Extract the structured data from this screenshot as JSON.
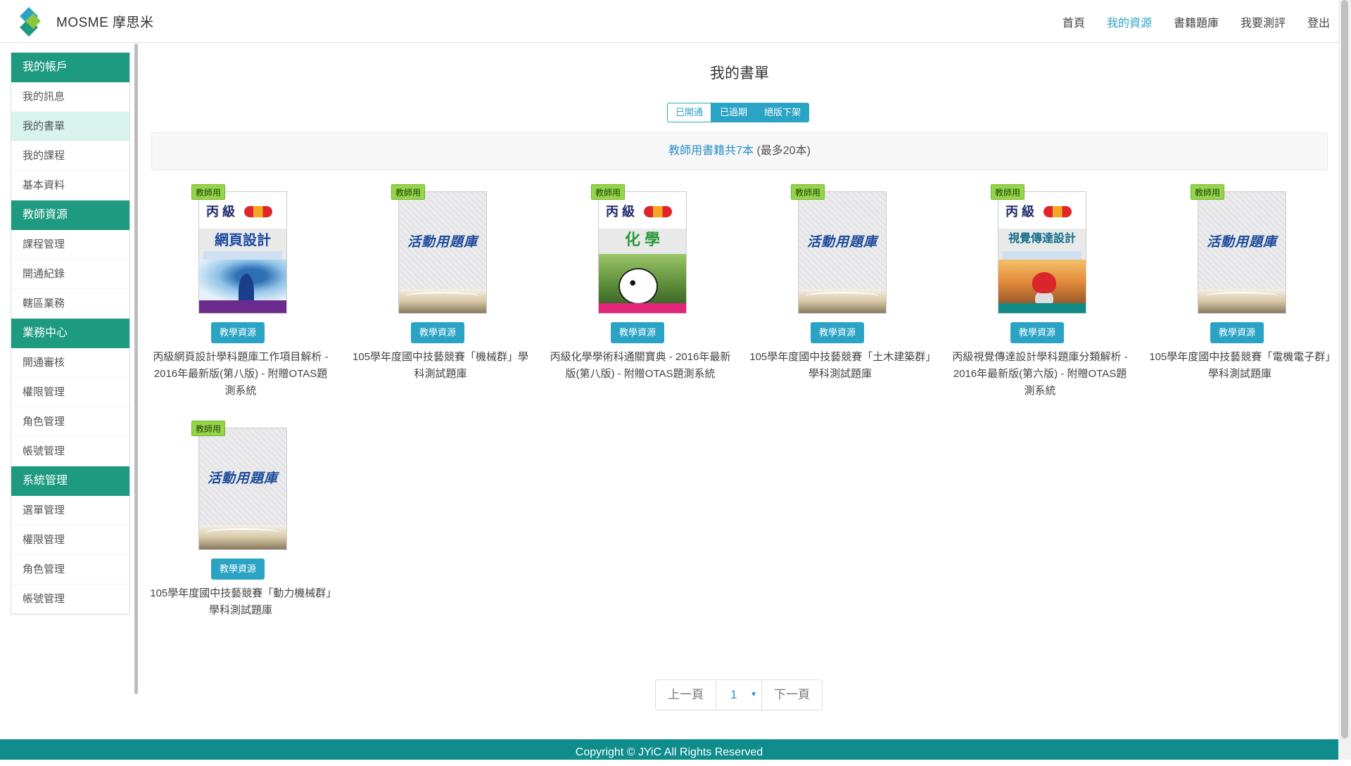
{
  "brand": {
    "name": "MOSME 摩思米"
  },
  "nav": [
    {
      "label": "首頁",
      "active": false
    },
    {
      "label": "我的資源",
      "active": true
    },
    {
      "label": "書籍題庫",
      "active": false
    },
    {
      "label": "我要測評",
      "active": false
    },
    {
      "label": "登出",
      "active": false
    }
  ],
  "sidebar": {
    "sections": [
      {
        "title": "我的帳戶",
        "items": [
          "我的訊息",
          "我的書單",
          "我的課程",
          "基本資料"
        ]
      },
      {
        "title": "教師資源",
        "items": [
          "課程管理",
          "開通紀錄",
          "轄區業務"
        ]
      },
      {
        "title": "業務中心",
        "items": [
          "開通審核",
          "權限管理",
          "角色管理",
          "帳號管理"
        ]
      },
      {
        "title": "系統管理",
        "items": [
          "選單管理",
          "權限管理",
          "角色管理",
          "帳號管理"
        ]
      }
    ],
    "active_item": "我的書單"
  },
  "page": {
    "title": "我的書單",
    "filters": [
      "已開通",
      "已過期",
      "絕版下架"
    ],
    "active_filter": "已開通",
    "info_link": "教師用書籍共7本",
    "info_rest": " (最多20本)"
  },
  "badge_label": "教師用",
  "resource_button": "教學資源",
  "books": [
    {
      "title": "丙級網頁設計學科題庫工作項目解析 - 2016年最新版(第八版) - 附贈OTAS題測系統",
      "cover": "webdesign",
      "cover_heading": "網頁設計",
      "cover_tag": "丙 級"
    },
    {
      "title": "105學年度國中技藝競賽「機械群」學科測試題庫",
      "cover": "activity",
      "cover_heading": "活動用題庫"
    },
    {
      "title": "丙級化學學術科通關寶典 - 2016年最新版(第八版) - 附贈OTAS題測系統",
      "cover": "chemistry",
      "cover_heading": "化 學",
      "cover_tag": "丙 級"
    },
    {
      "title": "105學年度國中技藝競賽「土木建築群」學科測試題庫",
      "cover": "activity",
      "cover_heading": "活動用題庫"
    },
    {
      "title": "丙級視覺傳達設計學科題庫分類解析 - 2016年最新版(第六版) - 附贈OTAS題測系統",
      "cover": "visual",
      "cover_heading": "視覺傳達設計",
      "cover_tag": "丙 級"
    },
    {
      "title": "105學年度國中技藝競賽「電機電子群」學科測試題庫",
      "cover": "activity",
      "cover_heading": "活動用題庫"
    },
    {
      "title": "105學年度國中技藝競賽「動力機械群」學科測試題庫",
      "cover": "activity",
      "cover_heading": "活動用題庫"
    }
  ],
  "pager": {
    "prev": "上一頁",
    "current": "1",
    "next": "下一頁"
  },
  "footer": "Copyright © JYiC All Rights Reserved",
  "colors": {
    "accent": "#2aa3c4",
    "sidebar_header": "#1e9a80",
    "footer": "#0f8c8c",
    "badge": "#94d54a"
  }
}
